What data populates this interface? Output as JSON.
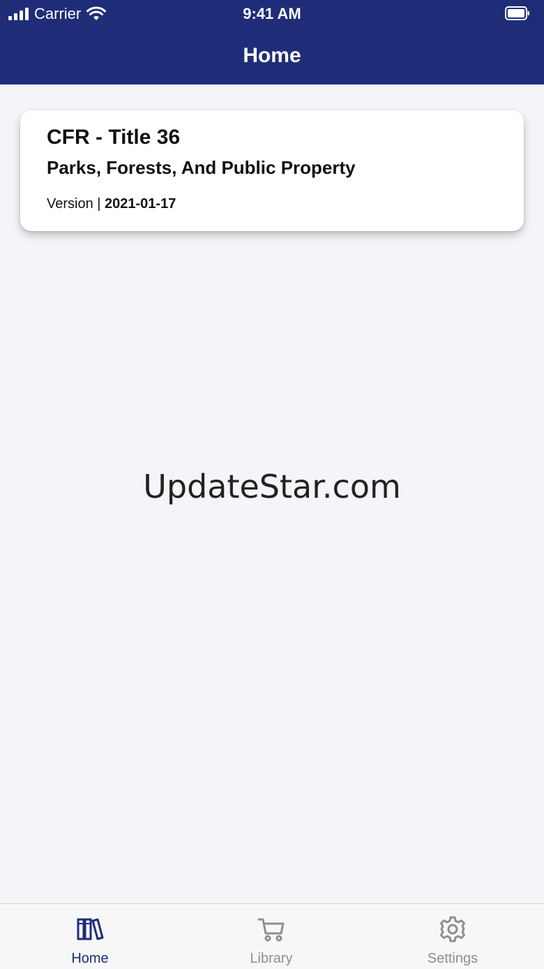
{
  "status_bar": {
    "carrier": "Carrier",
    "time": "9:41 AM"
  },
  "nav": {
    "title": "Home"
  },
  "card": {
    "title": "CFR - Title 36",
    "subtitle": "Parks, Forests, And Public Property",
    "version_label": "Version |",
    "version_date": "2021-01-17"
  },
  "watermark": "UpdateStar.com",
  "tabbar": {
    "tabs": [
      {
        "label": "Home",
        "icon": "books-icon",
        "active": true
      },
      {
        "label": "Library",
        "icon": "cart-icon",
        "active": false
      },
      {
        "label": "Settings",
        "icon": "gear-icon",
        "active": false
      }
    ]
  },
  "colors": {
    "brand": "#1f2d78",
    "background": "#f3f5f8",
    "inactive_tab": "#8e8e93"
  }
}
